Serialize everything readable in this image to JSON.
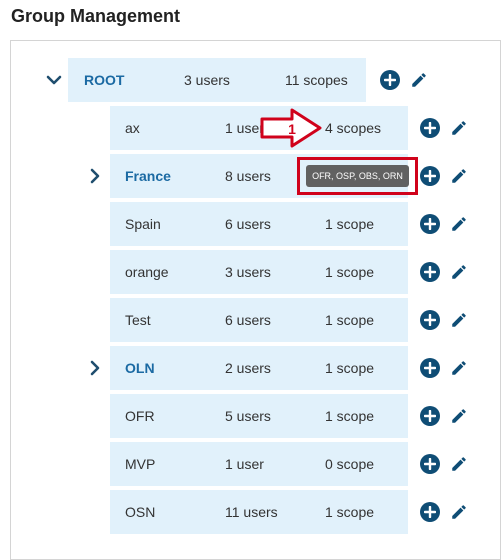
{
  "page": {
    "title": "Group Management"
  },
  "tooltip": {
    "text": "OFR, OSP, OBS, ORN"
  },
  "annotation": {
    "step_number": "1",
    "color": "#d0021b"
  },
  "colors": {
    "row_bg": "#e1f1fb",
    "link": "#1b6aa3",
    "action_icon": "#0f4d75"
  },
  "groups": [
    {
      "name": "ROOT",
      "users": "3 users",
      "scopes": "11 scopes",
      "expandable": true,
      "expanded": true
    },
    {
      "name": "ax",
      "users": "1 user",
      "scopes": "4 scopes",
      "expandable": false
    },
    {
      "name": "France",
      "users": "8 users",
      "scopes": "",
      "expandable": true,
      "expanded": false
    },
    {
      "name": "Spain",
      "users": "6 users",
      "scopes": "1 scope",
      "expandable": false
    },
    {
      "name": "orange",
      "users": "3 users",
      "scopes": "1 scope",
      "expandable": false
    },
    {
      "name": "Test",
      "users": "6 users",
      "scopes": "1 scope",
      "expandable": false
    },
    {
      "name": "OLN",
      "users": "2 users",
      "scopes": "1 scope",
      "expandable": true,
      "expanded": false
    },
    {
      "name": "OFR",
      "users": "5 users",
      "scopes": "1 scope",
      "expandable": false
    },
    {
      "name": "MVP",
      "users": "1 user",
      "scopes": "0 scope",
      "expandable": false
    },
    {
      "name": "OSN",
      "users": "11 users",
      "scopes": "1 scope",
      "expandable": false
    }
  ]
}
